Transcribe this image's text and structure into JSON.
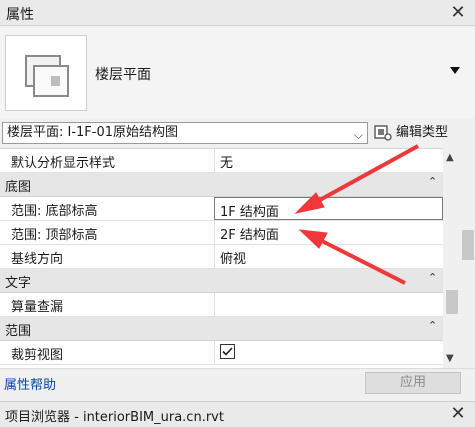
{
  "panel": {
    "title": "属性"
  },
  "type_selector": {
    "name": "楼层平面"
  },
  "instance_selector": {
    "value": "楼层平面: I-1F-01原始结构图",
    "edit_type_label": "编辑类型"
  },
  "grid": {
    "rows_top": [
      {
        "name": "默认分析显示样式",
        "value": "无"
      }
    ],
    "groups": {
      "underlay": "底图",
      "text": "文字",
      "extents": "范围"
    },
    "underlay_rows": [
      {
        "name": "范围: 底部标高",
        "value": "1F 结构面"
      },
      {
        "name": "范围: 顶部标高",
        "value": "2F 结构面"
      },
      {
        "name": "基线方向",
        "value": "俯视"
      }
    ],
    "text_rows": [
      {
        "name": "算量查漏",
        "value": ""
      }
    ],
    "extents_rows": [
      {
        "name": "裁剪视图",
        "checked": true
      }
    ]
  },
  "footer": {
    "help_link": "属性帮助",
    "apply_label": "应用"
  },
  "project_browser": {
    "title": "项目浏览器 - interiorBIM_ura.cn.rvt"
  },
  "colors": {
    "annotation_arrow": "#f0383a",
    "link": "#0645ad"
  }
}
